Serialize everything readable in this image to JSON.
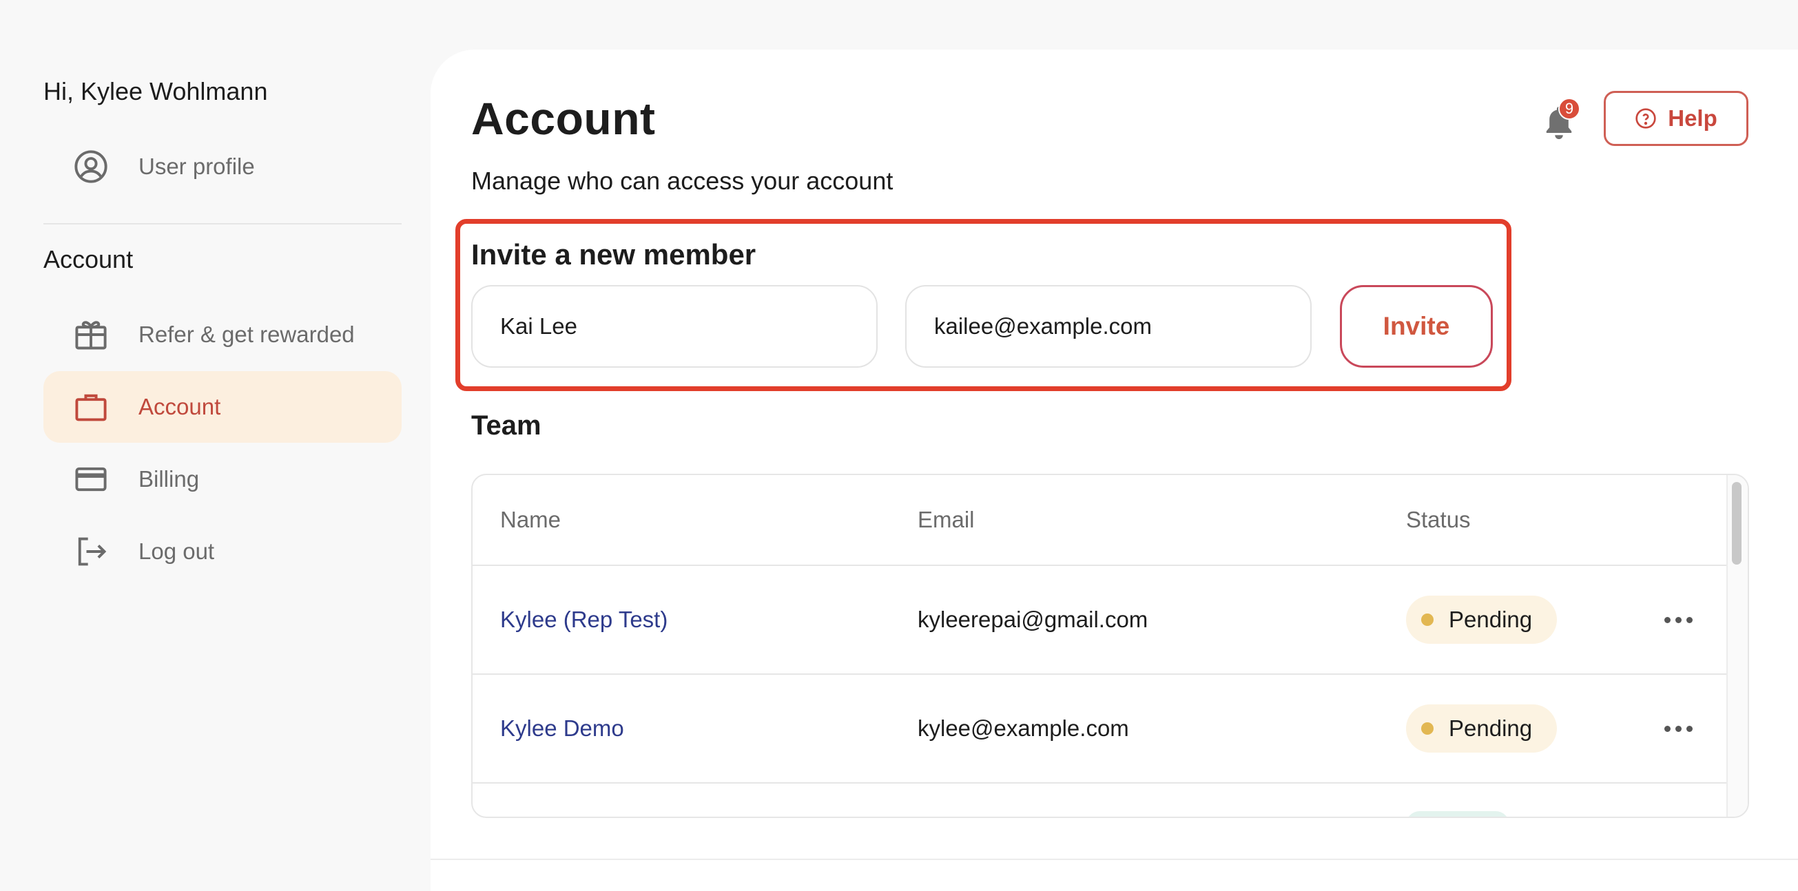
{
  "sidebar": {
    "greeting": "Hi, Kylee Wohlmann",
    "profile_item": {
      "label": "User profile",
      "icon": "user-circle-icon"
    },
    "section_title": "Account",
    "items": [
      {
        "label": "Refer & get rewarded",
        "icon": "gift-icon",
        "active": false
      },
      {
        "label": "Account",
        "icon": "briefcase-icon",
        "active": true
      },
      {
        "label": "Billing",
        "icon": "credit-card-icon",
        "active": false
      },
      {
        "label": "Log out",
        "icon": "logout-icon",
        "active": false
      }
    ]
  },
  "header": {
    "title": "Account",
    "subtitle": "Manage who can access your account",
    "notification_count": "9",
    "help_label": "Help"
  },
  "invite": {
    "title": "Invite a new member",
    "name_value": "Kai Lee",
    "email_value": "kailee@example.com",
    "button_label": "Invite"
  },
  "team": {
    "title": "Team",
    "columns": [
      "Name",
      "Email",
      "Status"
    ],
    "rows": [
      {
        "name": "Kylee (Rep Test)",
        "email": "kyleerepai@gmail.com",
        "status": "Pending"
      },
      {
        "name": "Kylee Demo",
        "email": "kylee@example.com",
        "status": "Pending"
      }
    ]
  },
  "colors": {
    "accent": "#c9473d",
    "active_bg": "#fcefdf",
    "highlight_border": "#e23e2b",
    "pending_dot": "#e2b752",
    "link": "#2e3b8c"
  }
}
